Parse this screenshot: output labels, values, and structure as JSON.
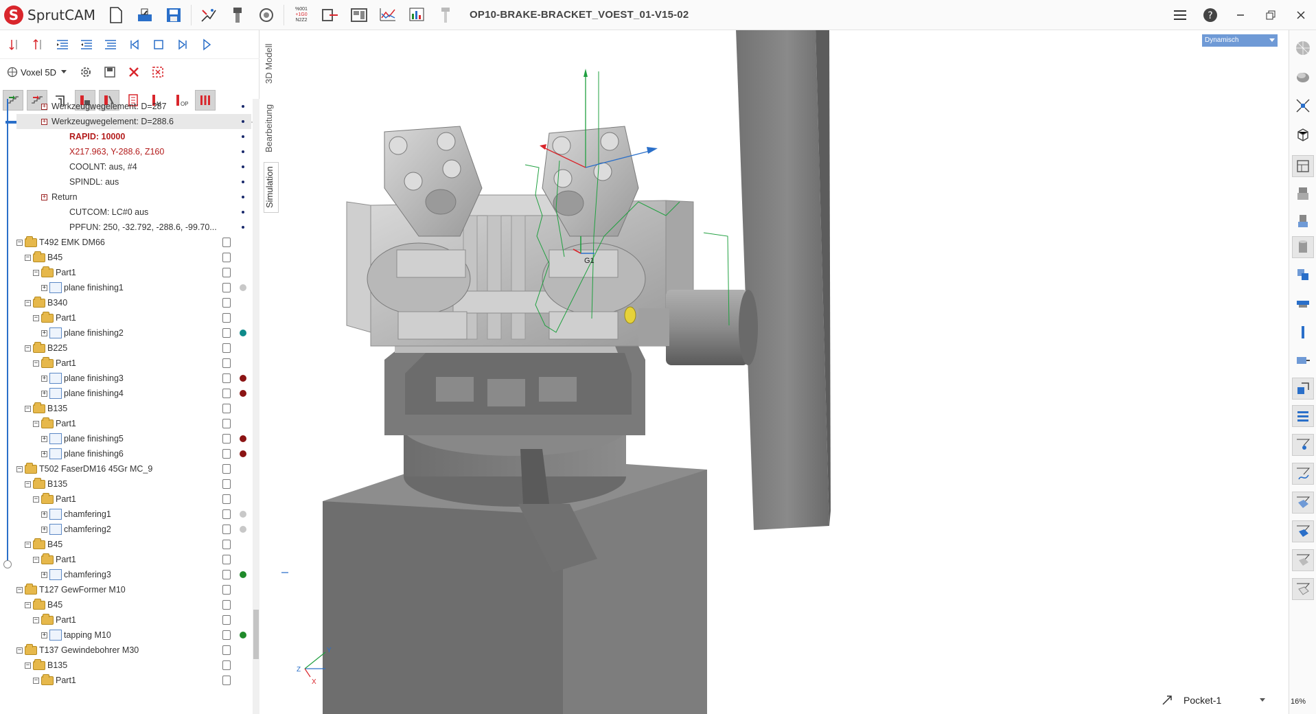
{
  "app": {
    "name": "SprutCAM",
    "logo_letter": "S",
    "project_title": "OP10-BRAKE-BRACKET_VOEST_01-V15-02"
  },
  "toolbar": {
    "icons": [
      "new-file-icon",
      "open-file-icon",
      "save-file-icon",
      "toolpath-icon",
      "tool-library-icon",
      "view-icon",
      "nc-code-icon",
      "machine-icon",
      "setup-icon",
      "chart-icon",
      "report-icon",
      "tool-icon"
    ],
    "nc_badge": "%001 +1G0 N2Z2"
  },
  "left": {
    "voxel_label": "Voxel 5D",
    "slider_percent": 36
  },
  "side_tabs": {
    "model": "3D Modell",
    "machining": "Bearbeitung",
    "simulation": "Simulation"
  },
  "tree": [
    {
      "indent": 3,
      "icon": "exp-red",
      "text": "Werkzeugwegelement: D=287",
      "right": "sdot"
    },
    {
      "indent": 3,
      "icon": "exp-red",
      "text": "Werkzeugwegelement: D=288.6",
      "right": "sdot",
      "selected": true
    },
    {
      "indent": 4,
      "icon": "none",
      "text": "RAPID: 10000",
      "style": "red bold",
      "right": "sdot"
    },
    {
      "indent": 4,
      "icon": "none",
      "text": "X217.963, Y-288.6, Z160",
      "style": "red",
      "right": "sdot"
    },
    {
      "indent": 4,
      "icon": "none",
      "text": "COOLNT: aus, #4",
      "right": "sdot"
    },
    {
      "indent": 4,
      "icon": "none",
      "text": "SPINDL: aus",
      "right": "sdot"
    },
    {
      "indent": 3,
      "icon": "exp-red",
      "text": "Return",
      "right": "sdot"
    },
    {
      "indent": 4,
      "icon": "none",
      "text": "CUTCOM: LC#0 aus",
      "right": "sdot"
    },
    {
      "indent": 4,
      "icon": "none",
      "text": "PPFUN: 250, -32.792, -288.6, -99.70...",
      "right": "sdot"
    },
    {
      "indent": 0,
      "icon": "folder",
      "text": "T492 EMK DM66",
      "right": "list"
    },
    {
      "indent": 1,
      "icon": "folder",
      "text": "B45",
      "right": "list"
    },
    {
      "indent": 2,
      "icon": "folder",
      "text": "Part1",
      "right": "list"
    },
    {
      "indent": 3,
      "icon": "op",
      "text": "plane finishing1",
      "right": "check",
      "dot": "#c8c8c8"
    },
    {
      "indent": 1,
      "icon": "folder",
      "text": "B340",
      "right": "list"
    },
    {
      "indent": 2,
      "icon": "folder",
      "text": "Part1",
      "right": "list"
    },
    {
      "indent": 3,
      "icon": "op",
      "text": "plane finishing2",
      "right": "check",
      "dot": "#0e8a8a"
    },
    {
      "indent": 1,
      "icon": "folder",
      "text": "B225",
      "right": "list"
    },
    {
      "indent": 2,
      "icon": "folder",
      "text": "Part1",
      "right": "list"
    },
    {
      "indent": 3,
      "icon": "op",
      "text": "plane finishing3",
      "right": "check",
      "dot": "#8b1414"
    },
    {
      "indent": 3,
      "icon": "op",
      "text": "plane finishing4",
      "right": "check",
      "dot": "#8b1414"
    },
    {
      "indent": 1,
      "icon": "folder",
      "text": "B135",
      "right": "list"
    },
    {
      "indent": 2,
      "icon": "folder",
      "text": "Part1",
      "right": "list"
    },
    {
      "indent": 3,
      "icon": "op",
      "text": "plane finishing5",
      "right": "check",
      "dot": "#8b1414"
    },
    {
      "indent": 3,
      "icon": "op",
      "text": "plane finishing6",
      "right": "check",
      "dot": "#8b1414"
    },
    {
      "indent": 0,
      "icon": "folder",
      "text": "T502 FaserDM16 45Gr MC_9",
      "right": "list"
    },
    {
      "indent": 1,
      "icon": "folder",
      "text": "B135",
      "right": "list"
    },
    {
      "indent": 2,
      "icon": "folder",
      "text": "Part1",
      "right": "list"
    },
    {
      "indent": 3,
      "icon": "op",
      "text": "chamfering1",
      "right": "check",
      "dot": "#c8c8c8"
    },
    {
      "indent": 3,
      "icon": "op",
      "text": "chamfering2",
      "right": "check",
      "dot": "#c8c8c8"
    },
    {
      "indent": 1,
      "icon": "folder",
      "text": "B45",
      "right": "list"
    },
    {
      "indent": 2,
      "icon": "folder",
      "text": "Part1",
      "right": "list"
    },
    {
      "indent": 3,
      "icon": "op",
      "text": "chamfering3",
      "right": "check",
      "dot": "#1f8a2a"
    },
    {
      "indent": 0,
      "icon": "folder",
      "text": "T127 GewFormer M10",
      "right": "list"
    },
    {
      "indent": 1,
      "icon": "folder",
      "text": "B45",
      "right": "list"
    },
    {
      "indent": 2,
      "icon": "folder",
      "text": "Part1",
      "right": "list"
    },
    {
      "indent": 3,
      "icon": "op",
      "text": "tapping M10",
      "right": "check",
      "dot": "#1f8a2a"
    },
    {
      "indent": 0,
      "icon": "folder",
      "text": "T137 Gewindebohrer M30",
      "right": "list"
    },
    {
      "indent": 1,
      "icon": "folder",
      "text": "B135",
      "right": "list"
    },
    {
      "indent": 2,
      "icon": "folder",
      "text": "Part1",
      "right": "list"
    }
  ],
  "viewport": {
    "mode_select": "Dynamisch",
    "g1_label": "G1",
    "axis_y": "Y",
    "axis_z": "Z",
    "axis_x": "X",
    "status_op": "Pocket-1",
    "zoom": "16%"
  },
  "colors": {
    "accent": "#2a6fc9",
    "brand": "#d9262c",
    "metal": "#9a9a9a",
    "dark_metal": "#6b6b6b"
  }
}
